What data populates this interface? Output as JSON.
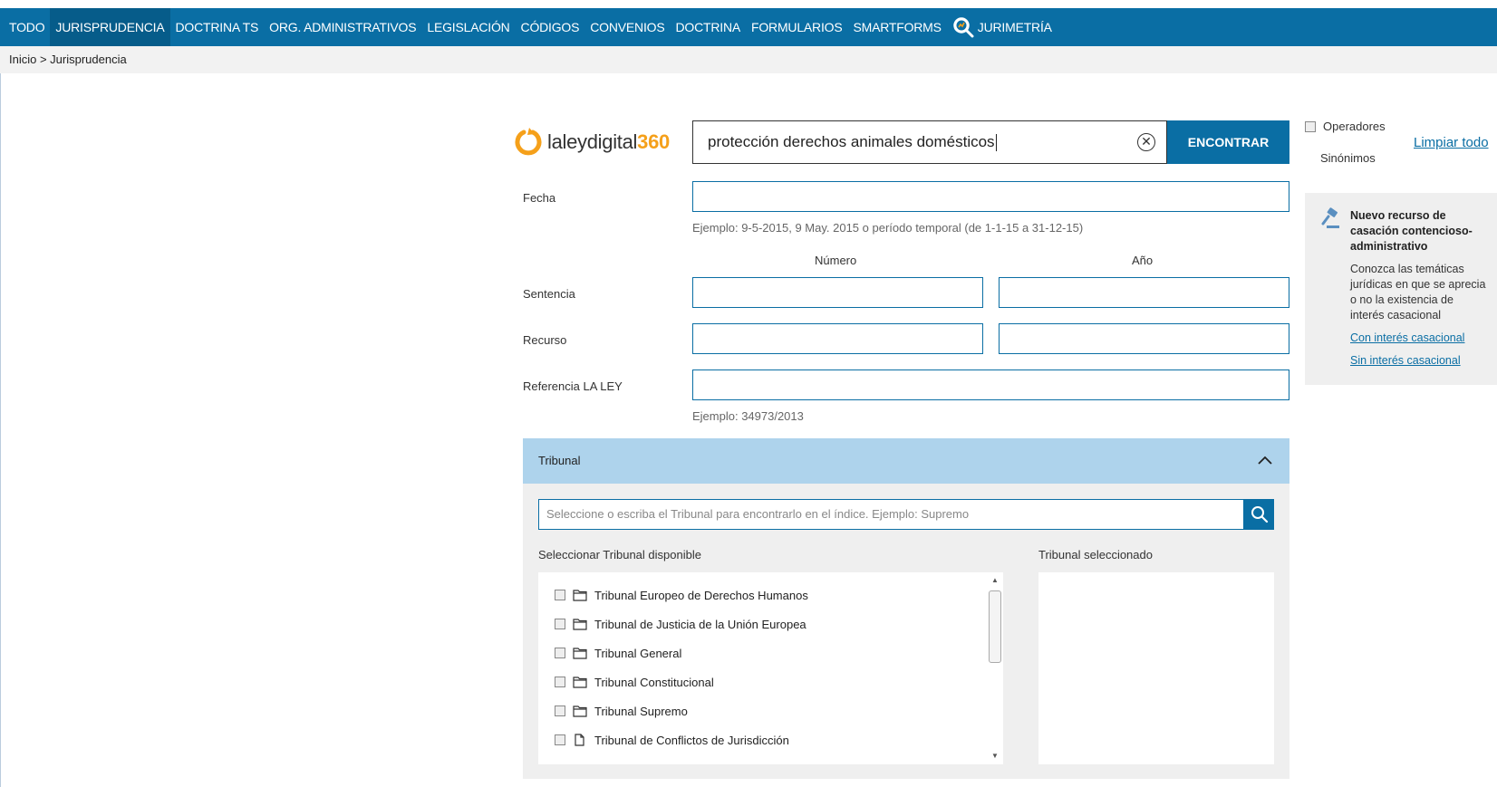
{
  "nav": {
    "items": [
      "TODO",
      "JURISPRUDENCIA",
      "DOCTRINA TS",
      "ORG. ADMINISTRATIVOS",
      "LEGISLACIÓN",
      "CÓDIGOS",
      "CONVENIOS",
      "DOCTRINA",
      "FORMULARIOS",
      "SMARTFORMS"
    ],
    "jurimetria": "JURIMETRÍA",
    "active": "JURISPRUDENCIA"
  },
  "breadcrumb": "Inicio > Jurisprudencia",
  "logo": {
    "text": "laleydigital",
    "accent": "360"
  },
  "search": {
    "query": "protección derechos animales domésticos",
    "button": "ENCONTRAR",
    "operators_label": "Operadores",
    "synonyms_label": "Sinónimos",
    "clear_all": "Limpiar todo"
  },
  "form": {
    "fecha_label": "Fecha",
    "fecha_hint": "Ejemplo: 9-5-2015, 9 May. 2015 o período temporal (de 1-1-15 a 31-12-15)",
    "numero_header": "Número",
    "ano_header": "Año",
    "sentencia_label": "Sentencia",
    "recurso_label": "Recurso",
    "referencia_label": "Referencia LA LEY",
    "referencia_hint": "Ejemplo: 34973/2013"
  },
  "tribunal": {
    "title": "Tribunal",
    "search_placeholder": "Seleccione o escriba el Tribunal para encontrarlo en el índice. Ejemplo: Supremo",
    "available_label": "Seleccionar Tribunal disponible",
    "selected_label": "Tribunal seleccionado",
    "items": [
      {
        "label": "Tribunal Europeo de Derechos Humanos",
        "icon": "folder-icon"
      },
      {
        "label": "Tribunal de Justicia de la Unión Europea",
        "icon": "folder-icon"
      },
      {
        "label": "Tribunal General",
        "icon": "folder-icon"
      },
      {
        "label": "Tribunal Constitucional",
        "icon": "folder-icon"
      },
      {
        "label": "Tribunal Supremo",
        "icon": "folder-icon"
      },
      {
        "label": "Tribunal de Conflictos de Jurisdicción",
        "icon": "document-icon"
      }
    ]
  },
  "sidebar_card": {
    "title": "Nuevo recurso de casación contencioso-administrativo",
    "text": "Conozca las temáticas jurídicas en que se aprecia o no la existencia de interés casacional",
    "link1": "Con interés casacional",
    "link2": "Sin interés casacional"
  },
  "colors": {
    "primary": "#0a6ea4",
    "accent": "#f5a01a",
    "tribunal_header": "#aed3ec"
  }
}
